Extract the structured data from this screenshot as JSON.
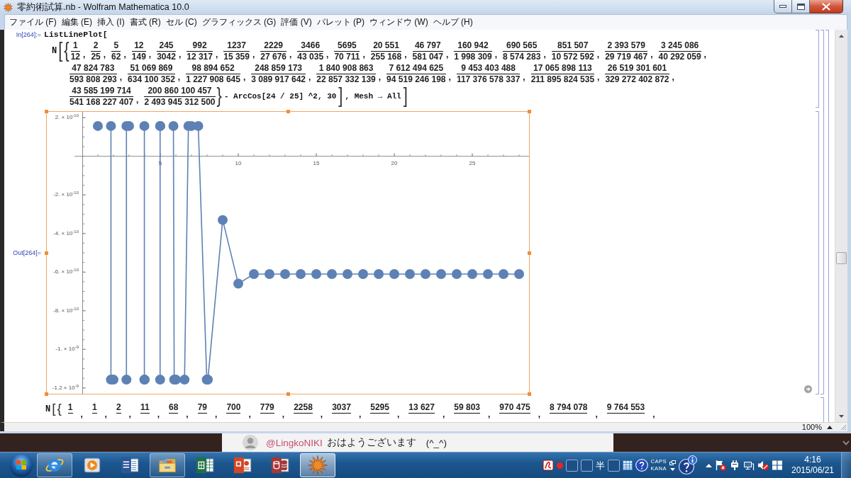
{
  "window": {
    "title": "零約術試算.nb - Wolfram Mathematica 10.0"
  },
  "menu": [
    "ファイル (F)",
    "編集 (E)",
    "挿入 (I)",
    "書式 (R)",
    "セル (C)",
    "グラフィックス (G)",
    "評価 (V)",
    "パレット (P)",
    "ウィンドウ (W)",
    "ヘルプ (H)"
  ],
  "input_cell": {
    "label": "In[264]:=",
    "code": "ListLinePlot[",
    "expression": {
      "head": "N",
      "open": [
        "[",
        "{"
      ],
      "lines": [
        [
          {
            "numerator": "1",
            "denominator": "12",
            "separator": ","
          },
          {
            "numerator": "2",
            "denominator": "25",
            "separator": ","
          },
          {
            "numerator": "5",
            "denominator": "62",
            "separator": ","
          },
          {
            "numerator": "12",
            "denominator": "149",
            "separator": ","
          },
          {
            "numerator": "245",
            "denominator": "3042",
            "separator": ","
          },
          {
            "numerator": "992",
            "denominator": "12 317",
            "separator": ","
          },
          {
            "numerator": "1237",
            "denominator": "15 359",
            "separator": ","
          },
          {
            "numerator": "2229",
            "denominator": "27 676",
            "separator": ","
          },
          {
            "numerator": "3466",
            "denominator": "43 035",
            "separator": ","
          },
          {
            "numerator": "5695",
            "denominator": "70 711",
            "separator": ","
          },
          {
            "numerator": "20 551",
            "denominator": "255 168",
            "separator": ","
          },
          {
            "numerator": "46 797",
            "denominator": "581 047",
            "separator": ","
          },
          {
            "numerator": "160 942",
            "denominator": "1 998 309",
            "separator": ","
          },
          {
            "numerator": "690 565",
            "denominator": "8 574 283",
            "separator": ","
          },
          {
            "numerator": "851 507",
            "denominator": "10 572 592",
            "separator": ","
          },
          {
            "numerator": "2 393 579",
            "denominator": "29 719 467",
            "separator": ","
          },
          {
            "numerator": "3 245 086",
            "denominator": "40 292 059",
            "separator": ","
          }
        ],
        [
          {
            "numerator": "47 824 783",
            "denominator": "593 808 293",
            "separator": ","
          },
          {
            "numerator": "51 069 869",
            "denominator": "634 100 352",
            "separator": ","
          },
          {
            "numerator": "98 894 652",
            "denominator": "1 227 908 645",
            "separator": ","
          },
          {
            "numerator": "248 859 173",
            "denominator": "3 089 917 642",
            "separator": ","
          },
          {
            "numerator": "1 840 908 863",
            "denominator": "22 857 332 139",
            "separator": ","
          },
          {
            "numerator": "7 612 494 625",
            "denominator": "94 519 246 198",
            "separator": ","
          },
          {
            "numerator": "9 453 403 488",
            "denominator": "117 376 578 337",
            "separator": ","
          },
          {
            "numerator": "17 065 898 113",
            "denominator": "211 895 824 535",
            "separator": ","
          },
          {
            "numerator": "26 519 301 601",
            "denominator": "329 272 402 872",
            "separator": ","
          }
        ],
        [
          {
            "numerator": "43 585 199 714",
            "denominator": "541 168 227 407",
            "separator": ","
          },
          {
            "numerator": "200 860 100 457",
            "denominator": "2 493 945 312 500"
          }
        ]
      ],
      "tail": [
        {
          "kind": "delimiter",
          "text": "}"
        },
        {
          "kind": "code",
          "text": "- ArcCos[24 / 25] ^2, 30"
        },
        {
          "kind": "delimiter",
          "text": "]"
        },
        {
          "kind": "code",
          "text": ", Mesh → All"
        },
        {
          "kind": "delimiter",
          "text": "]"
        }
      ]
    }
  },
  "output_cell": {
    "label": "Out[264]=",
    "plot": {
      "y_tick_labels": [
        "2. × 10$^{-10}$",
        "-2. × 10$^{-10}$",
        "-4. × 10$^{-10}$",
        "-6. × 10$^{-10}$",
        "-8. × 10$^{-10}$",
        "-1. × 10$^{-9}$",
        "-1.2 × 10$^{-9}$"
      ],
      "x_tick_labels": [
        "5",
        "10",
        "15",
        "20",
        "25"
      ]
    }
  },
  "next_cell": {
    "head": "N",
    "open": [
      "[",
      "{"
    ],
    "fractions": [
      {
        "numerator": "1",
        "separator": ","
      },
      {
        "numerator": "1",
        "separator": ","
      },
      {
        "numerator": "2",
        "separator": ","
      },
      {
        "numerator": "11",
        "separator": ","
      },
      {
        "numerator": "68",
        "separator": ","
      },
      {
        "numerator": "79",
        "separator": ","
      },
      {
        "numerator": "700",
        "separator": ","
      },
      {
        "numerator": "779",
        "separator": ","
      },
      {
        "numerator": "2258",
        "separator": ","
      },
      {
        "numerator": "3037",
        "separator": ","
      },
      {
        "numerator": "5295",
        "separator": ","
      },
      {
        "numerator": "13 627",
        "separator": ","
      },
      {
        "numerator": "59 803",
        "separator": ","
      },
      {
        "numerator": "970 475",
        "separator": ","
      },
      {
        "numerator": "8 794 078",
        "separator": ","
      },
      {
        "numerator": "9 764 553",
        "separator": ","
      }
    ]
  },
  "status_bar": {
    "zoom": "100%"
  },
  "notification": {
    "handle": "@LingkoNIKI",
    "message": "おはようございます",
    "emoticon": "(^_^)"
  },
  "taskbar": {
    "apps": [
      {
        "kind": "browser",
        "running": true,
        "selected": false
      },
      {
        "kind": "media",
        "running": false,
        "selected": false
      },
      {
        "kind": "document",
        "running": false,
        "selected": false
      },
      {
        "kind": "folder",
        "running": true,
        "selected": false
      },
      {
        "kind": "spreadsheet",
        "running": false,
        "selected": false
      },
      {
        "kind": "presentation",
        "running": false,
        "selected": false
      },
      {
        "kind": "database",
        "running": false,
        "selected": false
      },
      {
        "kind": "math",
        "running": true,
        "selected": true
      }
    ],
    "tray": {
      "input_mode": "半",
      "caps": "CAPS",
      "kana": "KANA"
    },
    "clock": {
      "time": "4:16",
      "date": "2015/06/21"
    }
  }
}
